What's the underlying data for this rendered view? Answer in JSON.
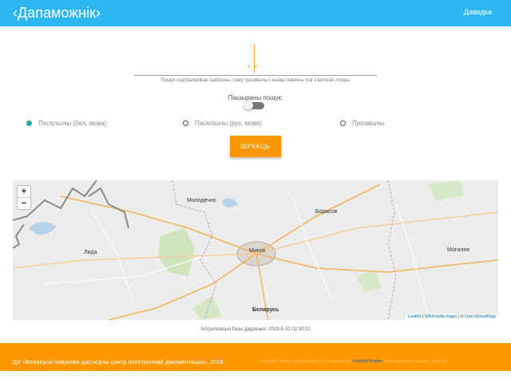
{
  "header": {
    "brand": "‹Дапаможнік›",
    "help_link": "Даведка"
  },
  "search": {
    "hint": "Пошук падтрымлівае шаблоны, таму прозвішчы і назвы павінны ісці з вялікай літары"
  },
  "advanced": {
    "label": "Пашыраны пошук:",
    "enabled": false
  },
  "options": [
    {
      "label": "Паселішчы (бел. мова)",
      "checked": true
    },
    {
      "label": "Паселішчы (рус. мова)",
      "checked": false
    },
    {
      "label": "Прозвішчы",
      "checked": false
    }
  ],
  "search_button": "ШУКАЦЬ",
  "map": {
    "zoom_in": "+",
    "zoom_out": "−",
    "cities": {
      "molodechno": "Молодечно",
      "borisov": "Борисов",
      "lida": "Лида",
      "minsk": "Минск",
      "mogilev": "Могилев",
      "belarus": "Беларусь"
    },
    "attribution": {
      "leaflet": "Leaflet",
      "sep1": " | ",
      "wikimedia": "Wikimedia maps",
      "sep2": " | © ",
      "osm": "OpenStreetMap"
    }
  },
  "db_update": "Актуалізацыя базы дадзеных: 2018-5-31 02:00:02",
  "footer": {
    "left": "ДУ «Беларускі навукова-даследчы цэнтр электроннай дакументацыі», 2016.",
    "right_pre": "Вячаслаў Рапейч (распрацоўка і база дадзеных), ",
    "right_name": "Алексей Воевич",
    "right_post": " (база дадзеных і дызайн праекта)"
  }
}
